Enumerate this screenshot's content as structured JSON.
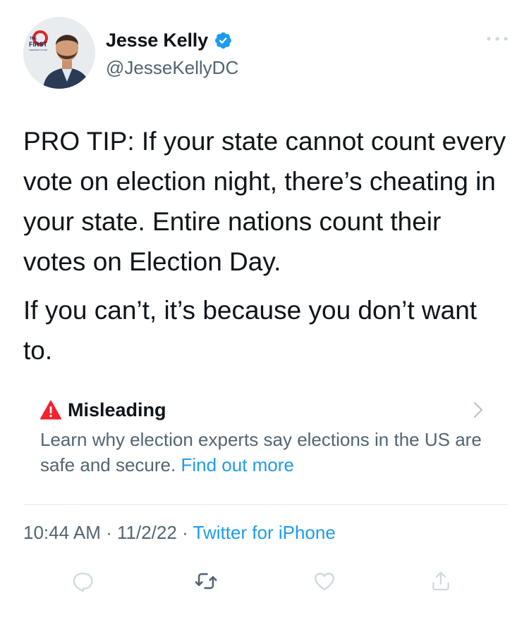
{
  "author": {
    "display_name": "Jesse Kelly",
    "handle": "@JesseKellyDC",
    "verified": true,
    "avatar_badge_top": "THE",
    "avatar_badge_main": "FIRST",
    "avatar_badge_url": "THEFIRSTTV.COM"
  },
  "tweet": {
    "paragraph_1": "PRO TIP: If your state cannot count every vote on election night, there’s cheating in your state. Entire nations count their votes on Election Day.",
    "paragraph_2": "If you can’t, it’s because you don’t want to."
  },
  "notice": {
    "title": "Misleading",
    "text": "Learn why election experts say elections in the US are safe and secure.",
    "link": "Find out more"
  },
  "meta": {
    "time": "10:44 AM",
    "separator": "·",
    "date": "11/2/22",
    "source": "Twitter for iPhone"
  },
  "colors": {
    "accent": "#1d9bf0",
    "secondary_text": "#536471",
    "warning": "#f4212e",
    "icon_gray": "#cfd9de",
    "icon_dark": "#536471"
  },
  "icons": {
    "verified": "verified-badge-icon",
    "more": "more-horizontal-icon",
    "warning": "warning-triangle-icon",
    "chevron": "chevron-right-icon",
    "reply": "reply-icon",
    "retweet": "retweet-icon",
    "like": "heart-icon",
    "share": "share-icon"
  }
}
